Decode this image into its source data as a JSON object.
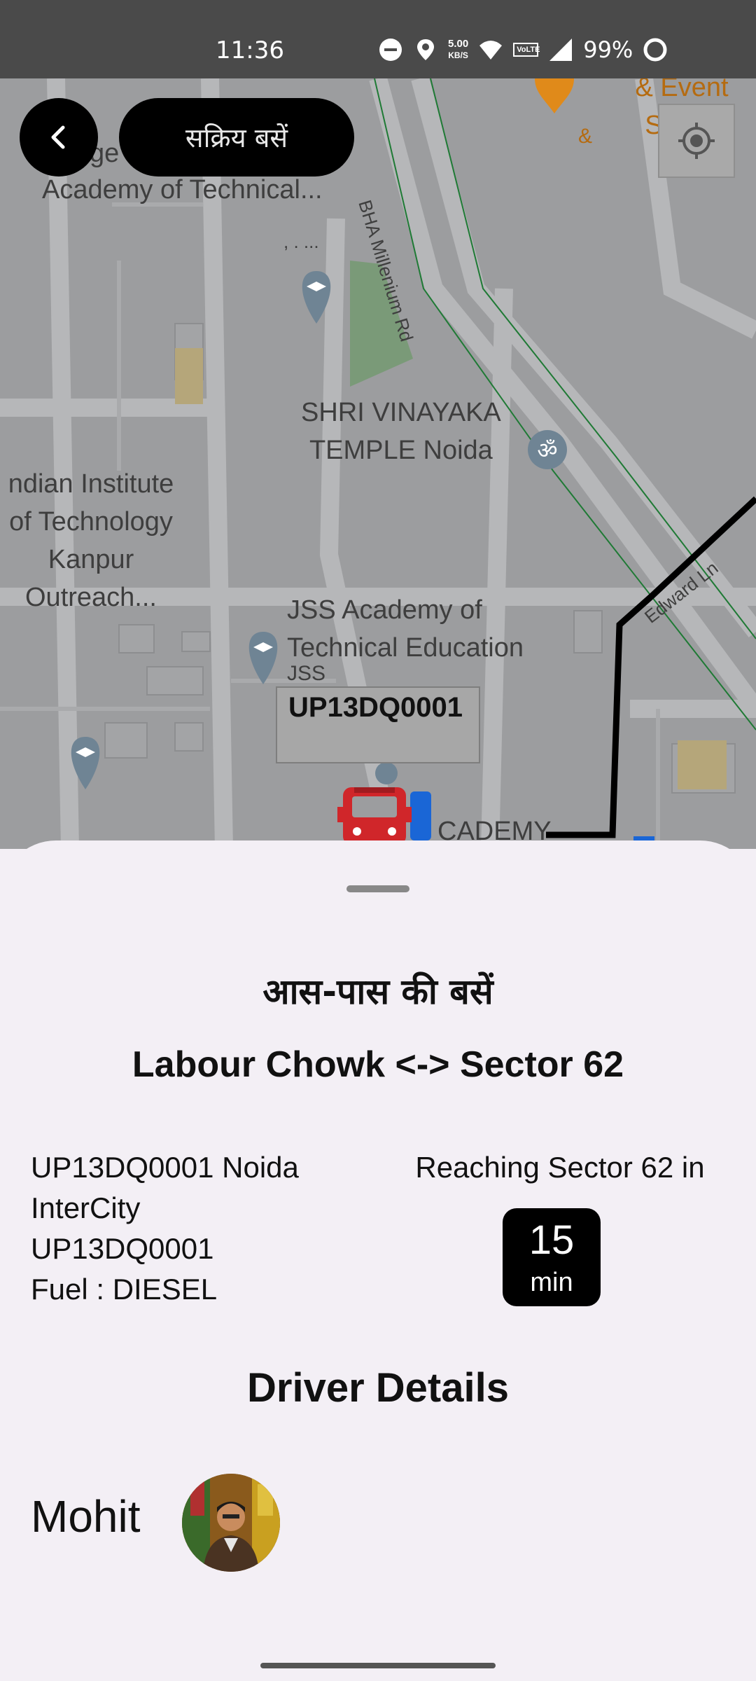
{
  "status_bar": {
    "time": "11:36",
    "netspeed_value": "5.00",
    "netspeed_unit": "KB/S",
    "volte": "VoLTE",
    "battery": "99%"
  },
  "header": {
    "title": "सक्रिय बसें"
  },
  "map": {
    "labels": {
      "college": "Academy of Technical...",
      "college_partial": "ge",
      "dots": ", . ...",
      "temple": "SHRI VINAYAKA\nTEMPLE Noida",
      "iit": "ndian Institute\nof Technology\nKanpur\nOutreach...",
      "jss": "JSS Academy of\nTechnical Education",
      "jss_short": "JSS",
      "academy": "CADEMY",
      "event": "& Event Servic",
      "ampersand": "&"
    },
    "roads": {
      "bha": "BHA Millenium Rd",
      "edward": "Edward Ln"
    },
    "bus_marker_label": "UP13DQ0001"
  },
  "sheet": {
    "title": "आस-पास की बसें",
    "route": "Labour Chowk  <-> Sector 62",
    "bus_info": {
      "line1": "UP13DQ0001 Noida",
      "line2": "InterCity",
      "line3": "UP13DQ0001",
      "line4": "Fuel : DIESEL"
    },
    "reaching_text": "Reaching Sector 62  in",
    "eta": {
      "value": "15",
      "unit": "min"
    },
    "driver_heading": "Driver Details",
    "driver_name": "Mohit"
  },
  "icons": {
    "back": "chevron-left-icon",
    "locate": "crosshair-icon",
    "bus": "bus-icon",
    "school": "school-pin-icon",
    "temple": "om-pin-icon"
  },
  "colors": {
    "map_bg": "#9c9d9f",
    "route": "#000000",
    "bus_red": "#d0262a",
    "pin_orange": "#e08a1a",
    "sheet_bg": "#f3eff5"
  }
}
